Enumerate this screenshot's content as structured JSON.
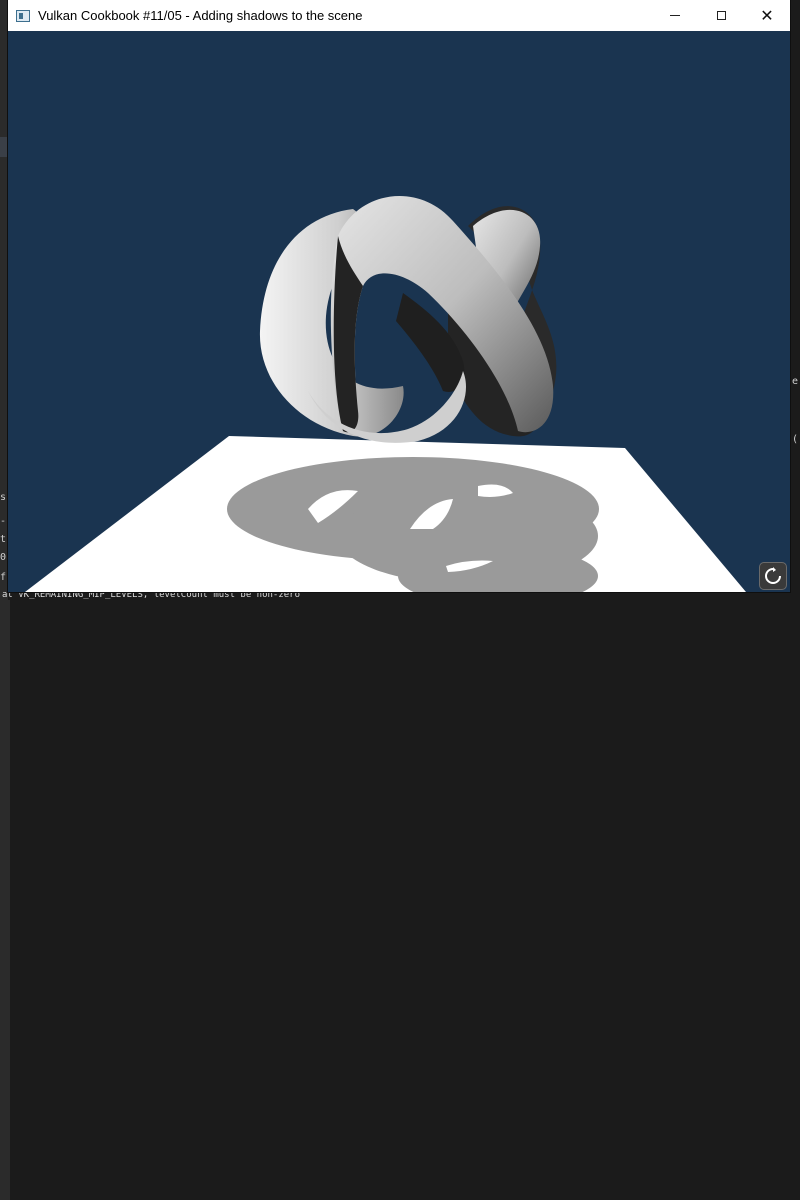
{
  "window": {
    "title": "Vulkan Cookbook #11/05 - Adding shadows to the scene",
    "icon": "app-window-icon"
  },
  "controls": {
    "minimize": "minimize-icon",
    "maximize": "maximize-icon",
    "close": "✕"
  },
  "background": {
    "console_line": "at VK_REMAINING_MIP_LEVELS, levelCount must be non-zero",
    "left_fragments": [
      "s",
      "-",
      "t",
      "0",
      "f"
    ],
    "right_fragments": [
      "e",
      "("
    ]
  },
  "colors": {
    "clear_color": "#1a3450",
    "plane": "#ffffff",
    "shadow": "#9a9a9a",
    "model_light": "#e8e8e8",
    "model_dark": "#242424"
  },
  "refresh_icon": "refresh-icon"
}
